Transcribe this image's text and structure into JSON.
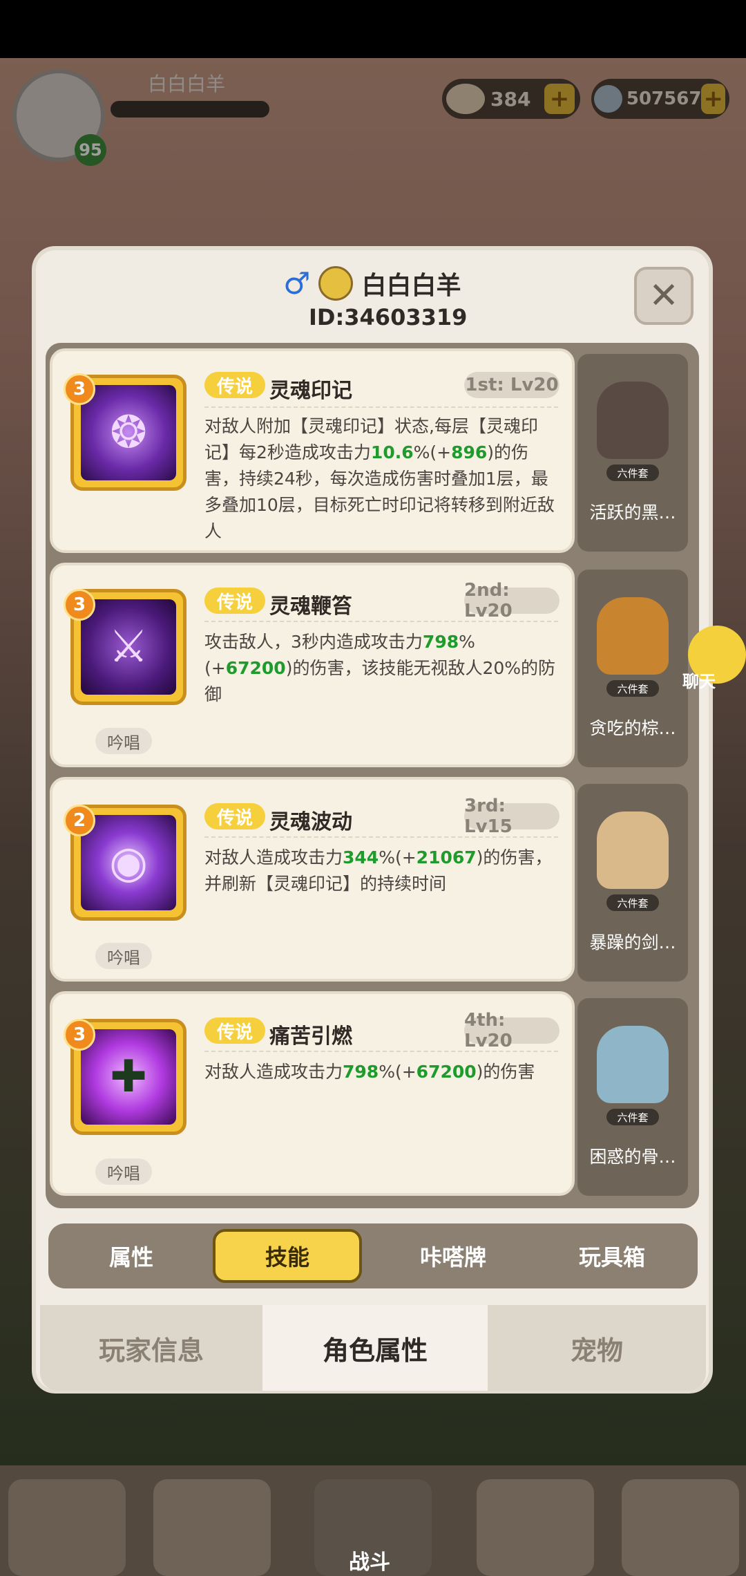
{
  "hud": {
    "player_name": "白白白羊",
    "level": "95",
    "resources": [
      {
        "icon": "shell-currency-icon",
        "value": "384"
      },
      {
        "icon": "gem-currency-icon",
        "value": "507567"
      }
    ]
  },
  "profile": {
    "gender_icon": "male-icon",
    "name": "白白白羊",
    "id": "ID:34603319"
  },
  "skills": [
    {
      "stars": "3",
      "rarity": "传说",
      "name": "灵魂印记",
      "slot": "1st: Lv20",
      "desc_parts": [
        "对敌人附加【灵魂印记】状态,每层【灵魂印记】每2秒造成攻击力",
        "10.6",
        "%(+",
        "896",
        ")的伤害，持续24秒，每次造成伤害时叠加1层，最多叠加10层，目标死亡时印记将转移到附近敌人"
      ],
      "chant": "",
      "icon": "soul-flame-icon"
    },
    {
      "stars": "3",
      "rarity": "传说",
      "name": "灵魂鞭笞",
      "slot": "2nd: Lv20",
      "desc_parts": [
        "攻击敌人，3秒内造成攻击力",
        "798",
        "%(+",
        "67200",
        ")的伤害，该技能无视敌人20%的防御"
      ],
      "chant": "吟唱",
      "icon": "soul-whip-icon"
    },
    {
      "stars": "2",
      "rarity": "传说",
      "name": "灵魂波动",
      "slot": "3rd: Lv15",
      "desc_parts": [
        "对敌人造成攻击力",
        "344",
        "%(+",
        "21067",
        ")的伤害，并刷新【灵魂印记】的持续时间"
      ],
      "chant": "吟唱",
      "icon": "soul-wave-icon"
    },
    {
      "stars": "3",
      "rarity": "传说",
      "name": "痛苦引燃",
      "slot": "4th: Lv20",
      "desc_parts": [
        "对敌人造成攻击力",
        "798",
        "%(+",
        "67200",
        ")的伤害"
      ],
      "chant": "吟唱",
      "icon": "pain-ignite-icon"
    }
  ],
  "toys": [
    {
      "set": "六件套",
      "name": "活跃的黑…",
      "color": "#5a4a44"
    },
    {
      "set": "六件套",
      "name": "贪吃的棕…",
      "color": "#c8842e"
    },
    {
      "set": "六件套",
      "name": "暴躁的剑…",
      "color": "#d9b88a"
    },
    {
      "set": "六件套",
      "name": "困惑的骨…",
      "color": "#8fb6c8"
    }
  ],
  "chat": {
    "label": "聊天"
  },
  "sub_tabs": [
    "属性",
    "技能",
    "咔嗒牌",
    "玩具箱"
  ],
  "sub_tab_active": "技能",
  "main_tabs": [
    "玩家信息",
    "角色属性",
    "宠物"
  ],
  "main_tab_active": "角色属性",
  "bottom_nav": {
    "battle_label": "战斗"
  },
  "colors": {
    "accent": "#f6d34a",
    "highlight_number": "#1f9a2c",
    "legend_tag": "#f6cf3c"
  }
}
